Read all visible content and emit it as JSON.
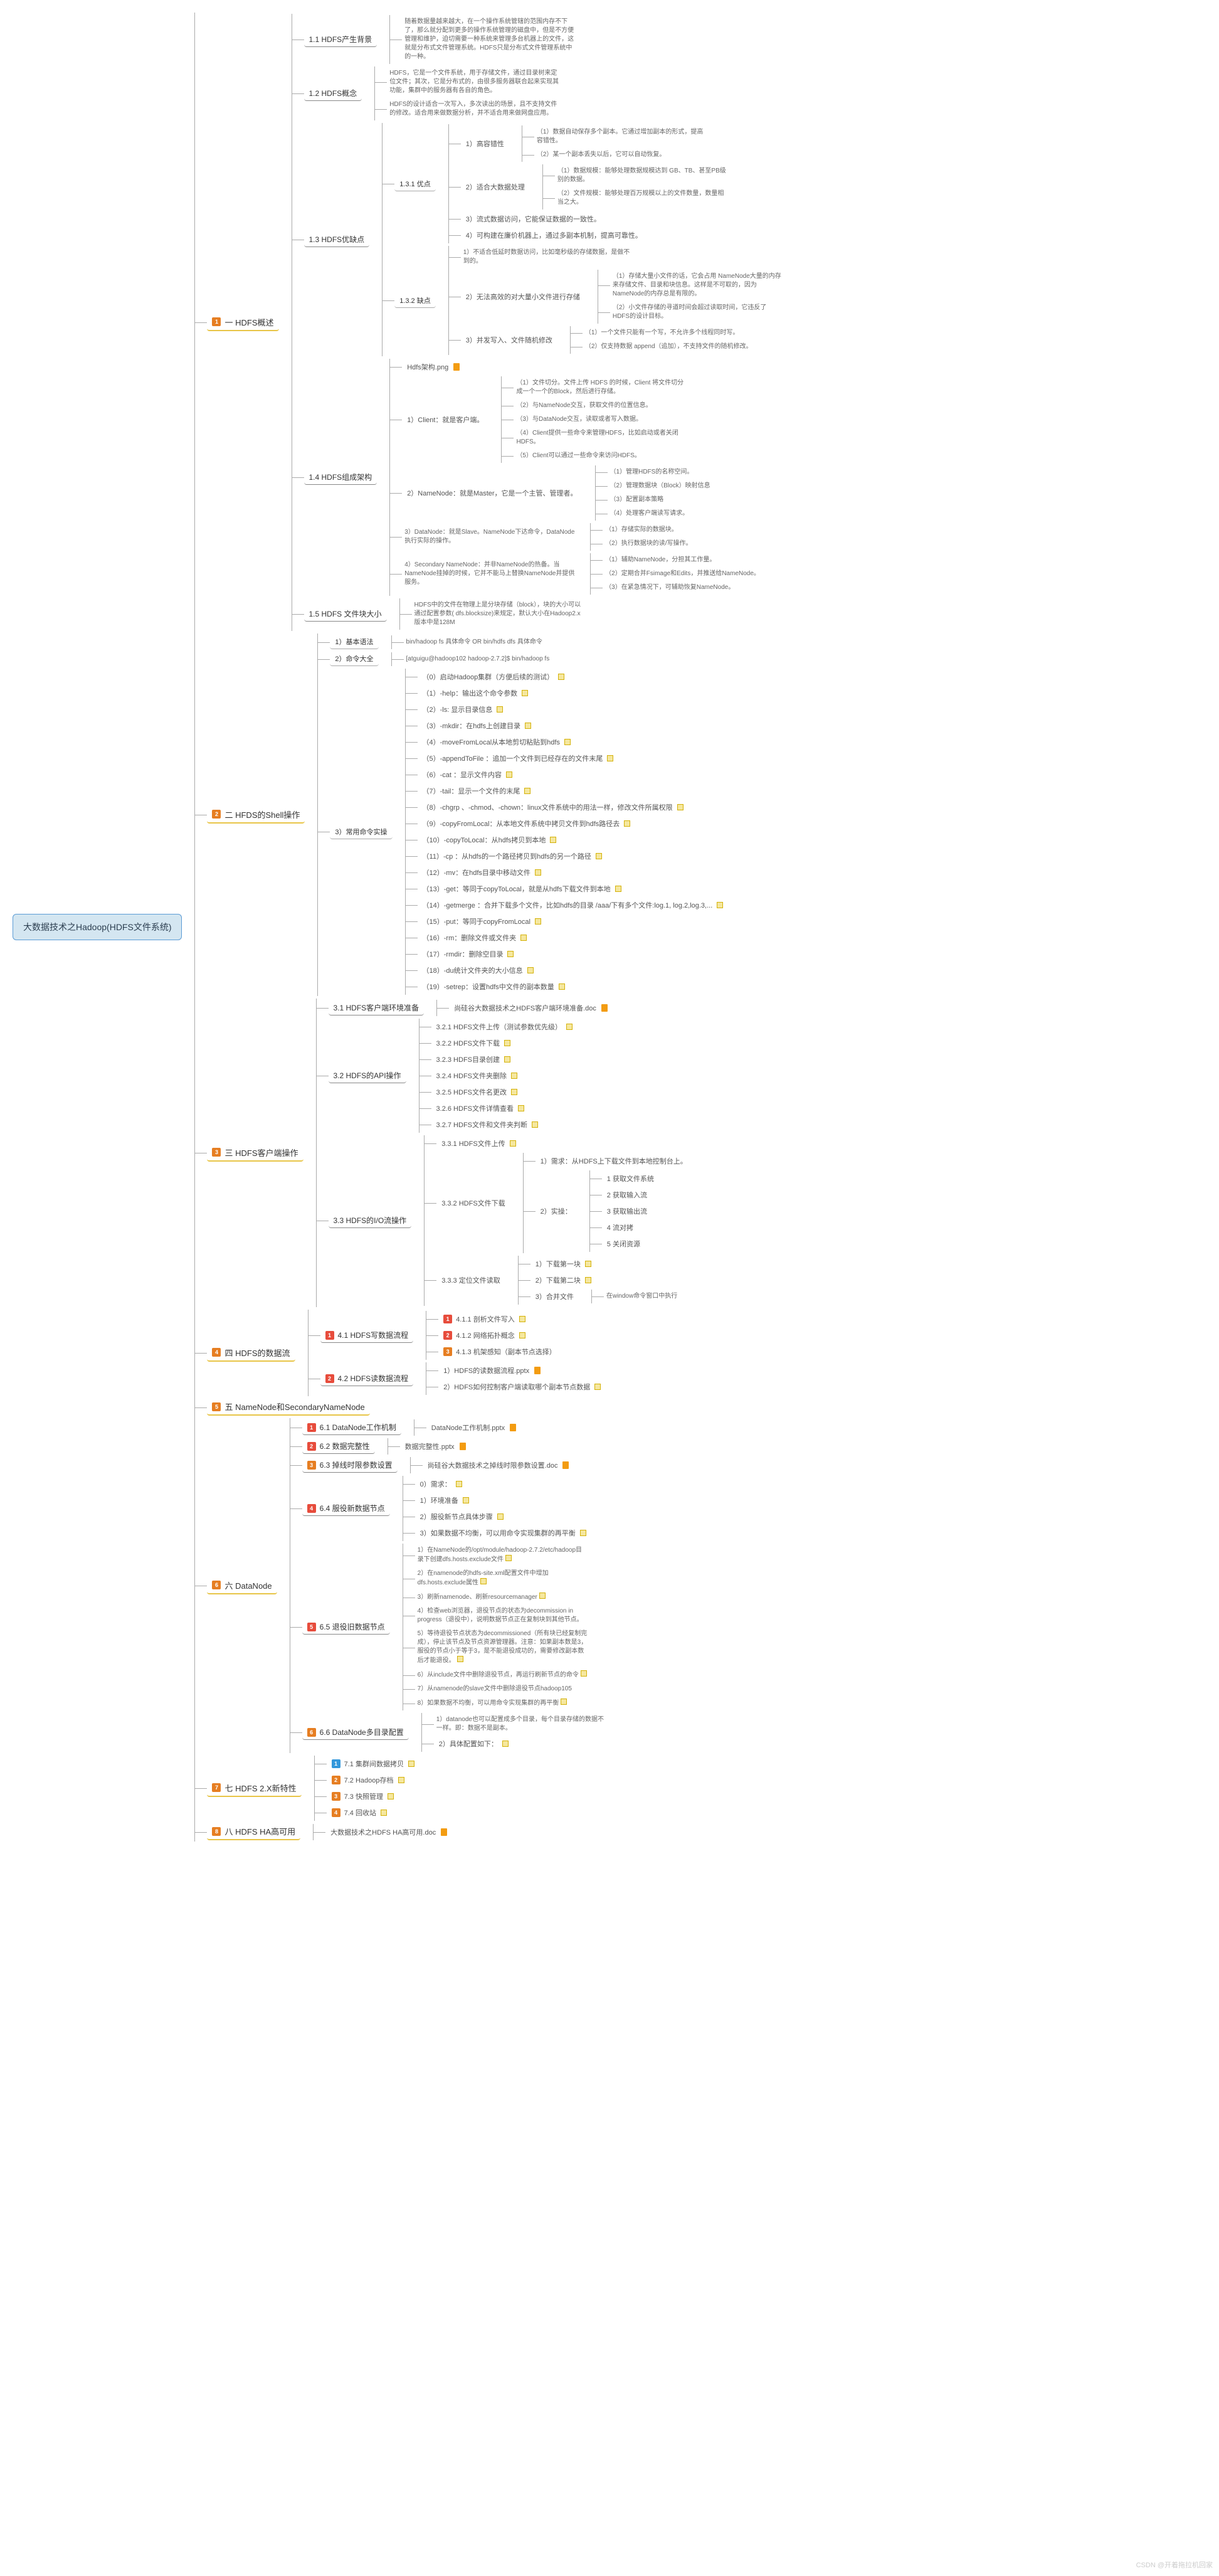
{
  "root_title": "大数据技术之Hadoop(HDFS文件系统)",
  "watermark": "CSDN @开着拖拉机回家",
  "sections": {
    "s1": {
      "num": "1",
      "label": "一 HDFS概述"
    },
    "s2": {
      "num": "2",
      "label": "二 HFDS的Shell操作"
    },
    "s3": {
      "num": "3",
      "label": "三 HDFS客户端操作"
    },
    "s4": {
      "num": "4",
      "label": "四 HDFS的数据流"
    },
    "s5": {
      "num": "5",
      "label": "五 NameNode和SecondaryNameNode"
    },
    "s6": {
      "num": "6",
      "label": "六 DataNode"
    },
    "s7": {
      "num": "7",
      "label": "七 HDFS 2.X新特性"
    },
    "s8": {
      "num": "8",
      "label": "八 HDFS HA高可用"
    }
  },
  "s1_1": {
    "label": "1.1 HDFS产生背景",
    "desc": "随着数据量越来越大，在一个操作系统管辖的范围内存不下了，那么就分配到更多的操作系统管理的磁盘中，但是不方便管理和维护，迫切需要一种系统来管理多台机器上的文件，这就是分布式文件管理系统。HDFS只是分布式文件管理系统中的一种。"
  },
  "s1_2": {
    "label": "1.2 HDFS概念",
    "desc1": "HDFS，它是一个文件系统，用于存储文件，通过目录树来定位文件；其次，它是分布式的，由很多服务器联合起来实现其功能，集群中的服务器有各自的角色。",
    "desc2": "HDFS的设计适合一次写入，多次读出的场景，且不支持文件的修改。适合用来做数据分析，并不适合用来做网盘应用。"
  },
  "s1_3": {
    "label": "1.3 HDFS优缺点"
  },
  "s1_3_1": {
    "label": "1.3.1 优点"
  },
  "s1_3_1_items": {
    "a": "1）高容错性",
    "a1": "（1）数据自动保存多个副本。它通过增加副本的形式，提高容错性。",
    "a2": "（2）某一个副本丢失以后，它可以自动恢复。",
    "b": "2）适合大数据处理",
    "b1": "（1）数据规模：能够处理数据规模达到 GB、TB、甚至PB级别的数据。",
    "b2": "（2）文件规模：能够处理百万规模以上的文件数量，数量相当之大。",
    "c": "3）流式数据访问，它能保证数据的一致性。",
    "d": "4）可构建在廉价机器上，通过多副本机制，提高可靠性。"
  },
  "s1_3_2": {
    "label": "1.3.2 缺点"
  },
  "s1_3_2_items": {
    "a": "1）不适合低延时数据访问，比如毫秒级的存储数据，是做不到的。",
    "b": "2）无法高效的对大量小文件进行存储",
    "b1": "（1）存储大量小文件的话，它会占用 NameNode大量的内存来存储文件、目录和块信息。这样是不可取的，因为NameNode的内存总是有限的。",
    "b2": "（2）小文件存储的寻道时间会超过读取时间，它违反了HDFS的设计目标。",
    "c": "3）并发写入、文件随机修改",
    "c1": "（1）一个文件只能有一个写，不允许多个线程同时写。",
    "c2": "（2）仅支持数据 append（追加），不支持文件的随机修改。"
  },
  "s1_4": {
    "label": "1.4 HDFS组成架构",
    "img": "Hdfs架构.png"
  },
  "s1_4_items": {
    "client": "1）Client：就是客户端。",
    "c1": "（1）文件切分。文件上传 HDFS 的时候，Client 将文件切分成一个一个的Block，然后进行存储。",
    "c2": "（2）与NameNode交互，获取文件的位置信息。",
    "c3": "（3）与DataNode交互，读取或者写入数据。",
    "c4": "（4）Client提供一些命令来管理HDFS，比如启动或者关闭HDFS。",
    "c5": "（5）Client可以通过一些命令来访问HDFS。",
    "nn": "2）NameNode：就是Master，它是一个主管、管理者。",
    "n1": "（1）管理HDFS的名称空间。",
    "n2": "（2）管理数据块（Block）映射信息",
    "n3": "（3）配置副本策略",
    "n4": "（4）处理客户端读写请求。",
    "dn": "3）DataNode：就是Slave。NameNode下达命令，DataNode执行实际的操作。",
    "d1": "（1）存储实际的数据块。",
    "d2": "（2）执行数据块的读/写操作。",
    "snn": "4）Secondary NameNode：并非NameNode的热备。当NameNode挂掉的时候，它并不能马上替换NameNode并提供服务。",
    "s1": "（1）辅助NameNode，分担其工作量。",
    "s2": "（2）定期合并Fsimage和Edits，并推送给NameNode。",
    "s3": "（3）在紧急情况下，可辅助恢复NameNode。"
  },
  "s1_5": {
    "label": "1.5 HDFS 文件块大小",
    "desc": "HDFS中的文件在物理上是分块存储（block），块的大小可以通过配置参数( dfs.blocksize)来规定，默认大小在Hadoop2.x版本中是128M"
  },
  "s2_items": {
    "a": "1）基本语法",
    "a_desc": "bin/hadoop fs 具体命令 OR  bin/hdfs dfs 具体命令",
    "b": "2）命令大全",
    "b_desc": "[atguigu@hadoop102 hadoop-2.7.2]$ bin/hadoop fs",
    "c": "3）常用命令实操",
    "c0": "（0）启动Hadoop集群（方便后续的测试）",
    "c1": "（1）-help：输出这个命令参数",
    "c2": "（2）-ls: 显示目录信息",
    "c3": "（3）-mkdir：在hdfs上创建目录",
    "c4": "（4）-moveFromLocal从本地剪切粘贴到hdfs",
    "c5": "（5）-appendToFile ：追加一个文件到已经存在的文件末尾",
    "c6": "（6）-cat ：显示文件内容",
    "c7": "（7）-tail：显示一个文件的末尾",
    "c8": "（8）-chgrp 、-chmod、-chown：linux文件系统中的用法一样，修改文件所属权限",
    "c9": "（9）-copyFromLocal：从本地文件系统中拷贝文件到hdfs路径去",
    "c10": "（10）-copyToLocal：从hdfs拷贝到本地",
    "c11": "（11）-cp ：从hdfs的一个路径拷贝到hdfs的另一个路径",
    "c12": "（12）-mv：在hdfs目录中移动文件",
    "c13": "（13）-get：等同于copyToLocal，就是从hdfs下载文件到本地",
    "c14": "（14）-getmerge ：合并下载多个文件，比如hdfs的目录 /aaa/下有多个文件:log.1, log.2,log.3,...",
    "c15": "（15）-put：等同于copyFromLocal",
    "c16": "（16）-rm：删除文件或文件夹",
    "c17": "（17）-rmdir：删除空目录",
    "c18": "（18）-du统计文件夹的大小信息",
    "c19": "（19）-setrep：设置hdfs中文件的副本数量"
  },
  "s3_1": {
    "label": "3.1 HDFS客户端环境准备",
    "file": "尚硅谷大数据技术之HDFS客户端环境准备.doc"
  },
  "s3_2": {
    "label": "3.2 HDFS的API操作"
  },
  "s3_2_items": {
    "a": "3.2.1 HDFS文件上传（测试参数优先级）",
    "b": "3.2.2 HDFS文件下载",
    "c": "3.2.3 HDFS目录创建",
    "d": "3.2.4 HDFS文件夹删除",
    "e": "3.2.5 HDFS文件名更改",
    "f": "3.2.6 HDFS文件详情查看",
    "g": "3.2.7 HDFS文件和文件夹判断"
  },
  "s3_3": {
    "label": "3.3 HDFS的I/O流操作"
  },
  "s3_3_items": {
    "a": "3.3.1 HDFS文件上传",
    "b": "3.3.2 HDFS文件下载",
    "b1": "1）需求：从HDFS上下载文件到本地控制台上。",
    "b2": "2）实操：",
    "b2_1": "1 获取文件系统",
    "b2_2": "2 获取输入流",
    "b2_3": "3 获取输出流",
    "b2_4": "4 流对拷",
    "b2_5": "5 关闭资源",
    "c": "3.3.3 定位文件读取",
    "c1": "1）下载第一块",
    "c2": "2）下载第二块",
    "c3": "3）合并文件",
    "c3_desc": "在window命令窗口中执行"
  },
  "s4_1": {
    "label": "4.1 HDFS写数据流程"
  },
  "s4_1_items": {
    "a": "4.1.1 剖析文件写入",
    "b": "4.1.2 网络拓扑概念",
    "c": "4.1.3 机架感知（副本节点选择）"
  },
  "s4_2": {
    "label": "4.2 HDFS读数据流程"
  },
  "s4_2_items": {
    "a": "1）HDFS的读数据流程.pptx",
    "b": "2）HDFS如何控制客户端读取哪个副本节点数据"
  },
  "s6_1": {
    "label": "6.1 DataNode工作机制",
    "file": "DataNode工作机制.pptx"
  },
  "s6_2": {
    "label": "6.2 数据完整性",
    "file": "数据完整性.pptx"
  },
  "s6_3": {
    "label": "6.3 掉线时限参数设置",
    "file": "尚硅谷大数据技术之掉线时限参数设置.doc"
  },
  "s6_4": {
    "label": "6.4 服役新数据节点"
  },
  "s6_4_items": {
    "a": "0）需求：",
    "b": "1）环境准备",
    "c": "2）服役新节点具体步骤",
    "d": "3）如果数据不均衡，可以用命令实现集群的再平衡"
  },
  "s6_5": {
    "label": "6.5 退役旧数据节点"
  },
  "s6_5_items": {
    "a": "1）在NameNode的/opt/module/hadoop-2.7.2/etc/hadoop目录下创建dfs.hosts.exclude文件",
    "b": "2）在namenode的hdfs-site.xml配置文件中增加dfs.hosts.exclude属性",
    "c": "3）刷新namenode、刷新resourcemanager",
    "d": "4）检查web浏览器，退役节点的状态为decommission in progress（退役中），说明数据节点正在复制块到其他节点。",
    "e": "5）等待退役节点状态为decommissioned（所有块已经复制完成），停止该节点及节点资源管理器。注意：如果副本数是3，服役的节点小于等于3，是不能退役成功的，需要修改副本数后才能退役。",
    "f": "6）从include文件中删除退役节点，再运行刷新节点的命令",
    "g": "7）从namenode的slave文件中删除退役节点hadoop105",
    "h": "8）如果数据不均衡，可以用命令实现集群的再平衡"
  },
  "s6_6": {
    "label": "6.6 DataNode多目录配置"
  },
  "s6_6_items": {
    "a": "1）datanode也可以配置成多个目录，每个目录存储的数据不一样。即：数据不是副本。",
    "b": "2）具体配置如下："
  },
  "s7_items": {
    "a": "7.1 集群间数据拷贝",
    "b": "7.2 Hadoop存档",
    "c": "7.3 快照管理",
    "d": "7.4 回收站"
  },
  "s8_file": "大数据技术之HDFS HA高可用.doc"
}
